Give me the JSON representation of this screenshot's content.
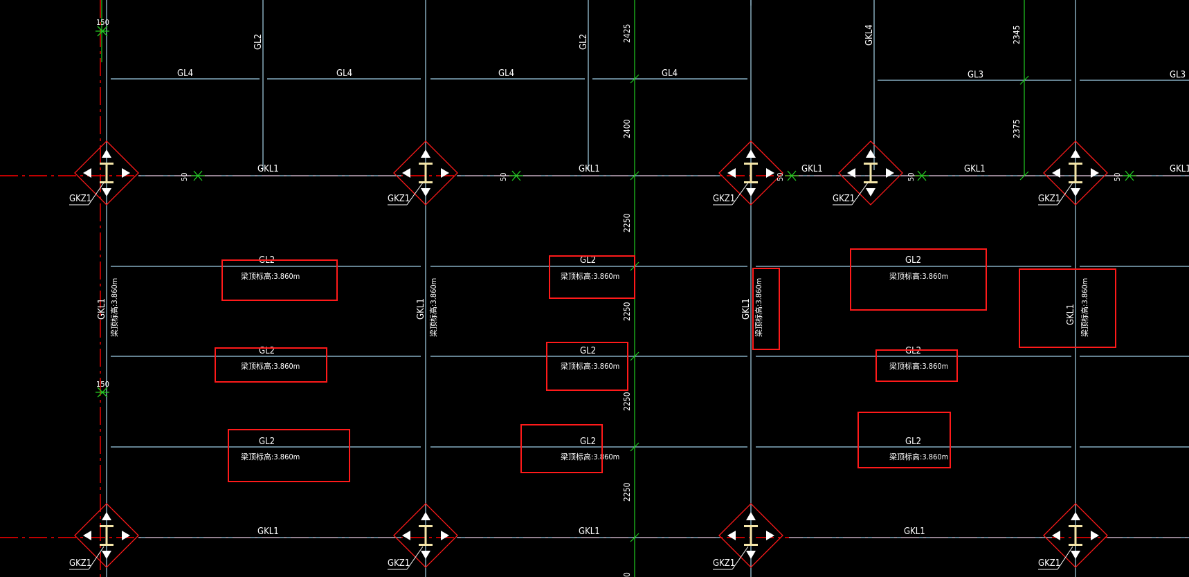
{
  "drawing": {
    "colors": {
      "background": "#000000",
      "axis": "#ff0000",
      "beam": "#9fd0e8",
      "column_line": "#a8d4ea",
      "highlight": "#ff1a1a",
      "dimension": "#22cc22",
      "column_symbol": "#f5e6a8",
      "text": "#ffffff"
    },
    "column_label": "GKZ1",
    "main_beam_label": "GKL1",
    "elevation_text": "梁顶标高:3.860m",
    "beam_labels": {
      "gl4": "GL4",
      "gl3": "GL3",
      "gl2": "GL2",
      "gkl4": "GKL4"
    },
    "offset_labels": {
      "o150": "150",
      "o50": "50"
    },
    "dimensions": [
      "2425",
      "2400",
      "2250",
      "2250",
      "2250",
      "2250",
      "0"
    ],
    "right_dimensions": [
      "2345",
      "2375"
    ]
  }
}
